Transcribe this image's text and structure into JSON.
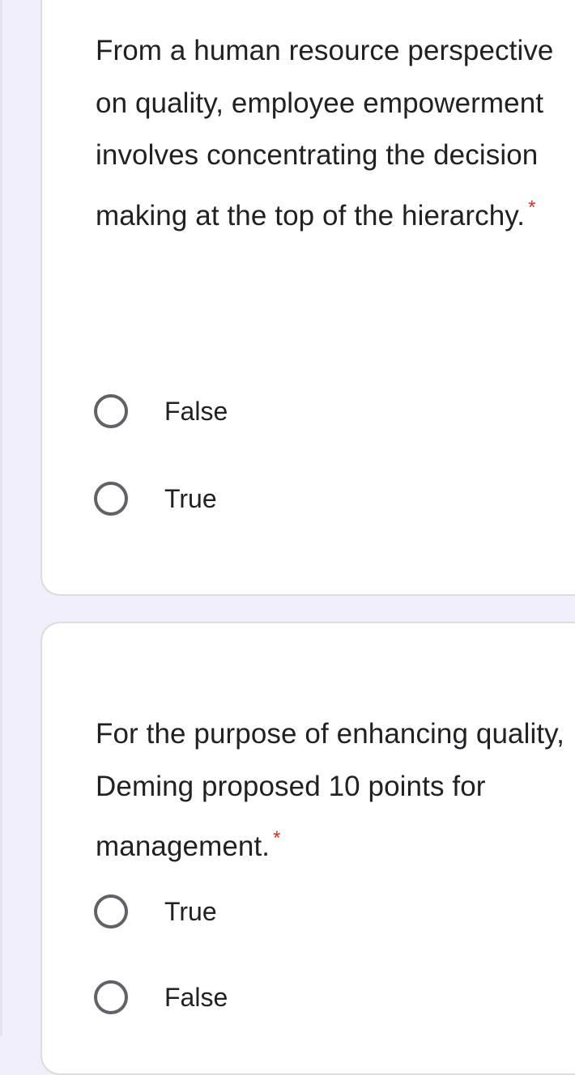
{
  "questions": [
    {
      "text": "From a human resource perspective on quality, employee empowerment involves concentrating the decision making at the top of the hierarchy.",
      "required_marker": "*",
      "options": [
        {
          "label": "False",
          "selected": false
        },
        {
          "label": "True",
          "selected": false
        }
      ]
    },
    {
      "text": "For the purpose of enhancing quality, Deming proposed 10 points for management.",
      "required_marker": "*",
      "options": [
        {
          "label": "True",
          "selected": false
        },
        {
          "label": "False",
          "selected": false
        }
      ]
    }
  ],
  "colors": {
    "background": "#f0eff9",
    "card": "#ffffff",
    "required": "#d93025",
    "radio_border": "#5f6368",
    "text": "#202124"
  }
}
